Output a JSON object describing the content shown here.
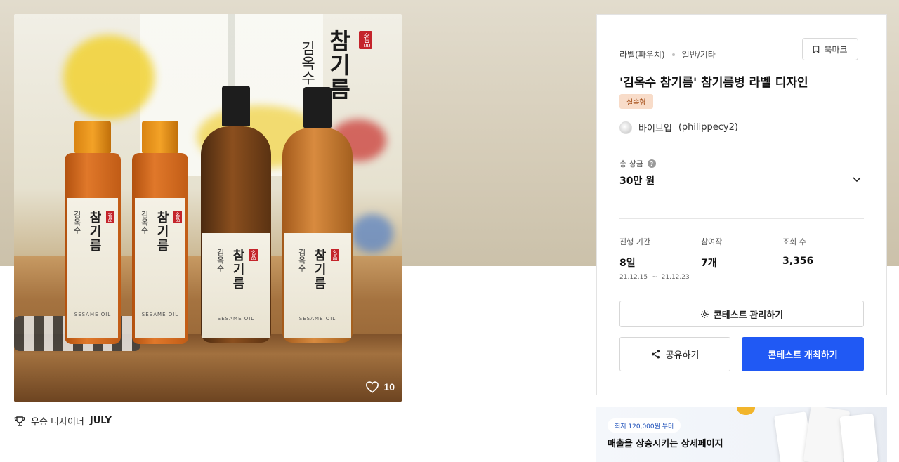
{
  "product": {
    "brand_main": "참기름",
    "brand_sub": "김옥수",
    "brand_seal": "名品",
    "label_main": "참기름",
    "label_sub": "김옥수",
    "label_oil": "SESAME OIL",
    "like_count": "10"
  },
  "award": {
    "prefix": "우승 디자이너",
    "designer": "JULY"
  },
  "panel": {
    "category": "라벨(파우치)",
    "subcategory": "일반/기타",
    "bookmark_label": "북마크",
    "title": "'김옥수 참기름' 참기름병 라벨 디자인",
    "badge": "실속형",
    "host_name": "바이브업",
    "host_id": "(philippecy2)",
    "prize_label": "총 상금",
    "prize_value": "30만 원",
    "stats": {
      "period_label": "진행 기간",
      "period_value": "8일",
      "period_start": "21.12.15",
      "period_sep": "~",
      "period_end": "21.12.23",
      "entries_label": "참여작",
      "entries_value": "7개",
      "views_label": "조회 수",
      "views_value": "3,356"
    },
    "manage_label": "콘테스트 관리하기",
    "share_label": "공유하기",
    "host_label": "콘테스트 개최하기"
  },
  "ad": {
    "chip": "최저 120,000원 부터",
    "text": "매출을 상승시키는 상세페이지"
  },
  "colors": {
    "primary": "#2059f4",
    "badge_bg": "#f8dcc9",
    "badge_text": "#a34b14",
    "seal": "#c4242b"
  }
}
